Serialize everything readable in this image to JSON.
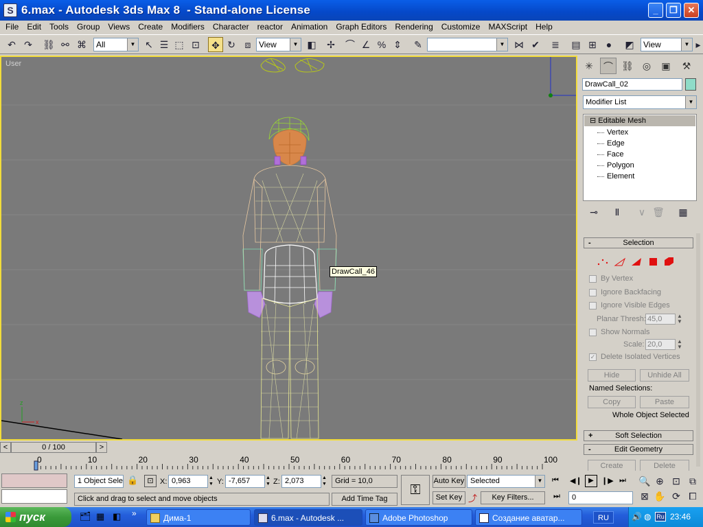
{
  "window": {
    "title": "6.max - Autodesk 3ds Max 8  - Stand-alone License",
    "minimize": "_",
    "maximize": "❐",
    "close": "✕"
  },
  "menu": [
    "File",
    "Edit",
    "Tools",
    "Group",
    "Views",
    "Create",
    "Modifiers",
    "Character",
    "reactor",
    "Animation",
    "Graph Editors",
    "Rendering",
    "Customize",
    "MAXScript",
    "Help"
  ],
  "toolbar": {
    "selection_filter": "All",
    "ref_coord": "View",
    "named_selection": "",
    "right_view": "View"
  },
  "viewport": {
    "label": "User",
    "tooltip": "DrawCall_46",
    "border_color": "#f2dc3a",
    "bg": "#7a7a7a"
  },
  "command_panel": {
    "object_name": "DrawCall_02",
    "object_color": "#8fdcc8",
    "modifier_list": "Modifier List",
    "stack": {
      "header": "Editable Mesh",
      "subs": [
        "Vertex",
        "Edge",
        "Face",
        "Polygon",
        "Element"
      ]
    },
    "selection": {
      "title": "Selection",
      "collapse": "-",
      "by_vertex": "By Vertex",
      "ignore_backfacing": "Ignore Backfacing",
      "ignore_visible_edges": "Ignore Visible Edges",
      "planar_thresh_label": "Planar Thresh:",
      "planar_thresh_value": "45,0",
      "show_normals": "Show Normals",
      "scale_label": "Scale:",
      "scale_value": "20,0",
      "delete_isolated": "Delete Isolated Vertices",
      "hide": "Hide",
      "unhide_all": "Unhide All",
      "named_selections": "Named Selections:",
      "copy": "Copy",
      "paste": "Paste",
      "status": "Whole Object Selected"
    },
    "soft_selection": {
      "title": "Soft Selection",
      "expand": "+"
    },
    "edit_geometry": {
      "title": "Edit Geometry",
      "collapse": "-",
      "create": "Create",
      "delete": "Delete"
    }
  },
  "timeline": {
    "frame": "0 / 100",
    "prev": "<",
    "next": ">",
    "ticks": [
      "0",
      "10",
      "20",
      "30",
      "40",
      "50",
      "60",
      "70",
      "80",
      "90",
      "100"
    ]
  },
  "status": {
    "selected_count": "1 Object Sele",
    "x_label": "X:",
    "x": "0,963",
    "y_label": "Y:",
    "y": "-7,657",
    "z_label": "Z:",
    "z": "2,073",
    "grid": "Grid = 10,0",
    "prompt": "Click and drag to select and move objects",
    "add_time_tag": "Add Time Tag",
    "auto_key": "Auto Key",
    "set_key": "Set Key",
    "key_mode": "Selected",
    "key_filters": "Key Filters...",
    "current_frame": "0"
  },
  "taskbar": {
    "start": "пуск",
    "tasks": [
      "Дима-1",
      "6.max - Autodesk ...",
      "Adobe Photoshop",
      "Создание аватар..."
    ],
    "lang": "RU",
    "tray_lang": "Ru",
    "time": "23:46"
  }
}
